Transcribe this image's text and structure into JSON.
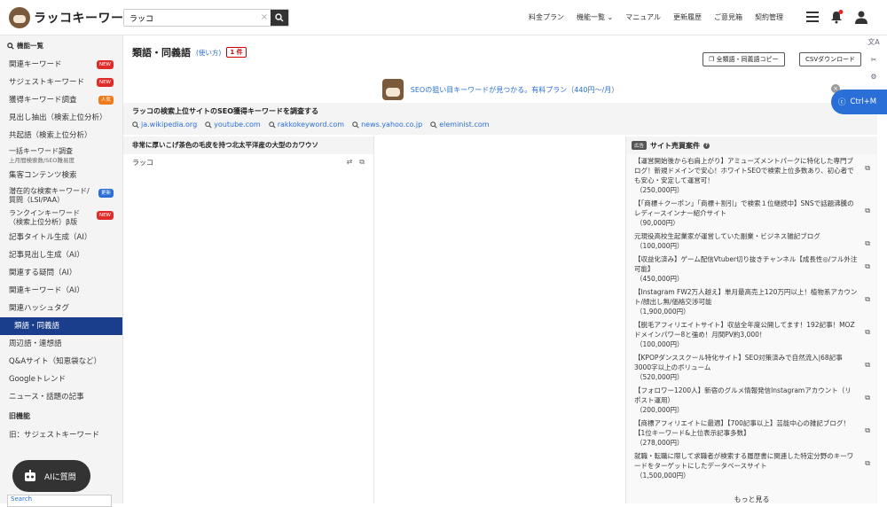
{
  "header": {
    "logo_text": "ラッコキーワード",
    "search_value": "ラッコ",
    "clear_symbol": "×",
    "nav": [
      "料金プラン",
      "機能一覧",
      "マニュアル",
      "更新履歴",
      "ご意見箱",
      "契約管理"
    ]
  },
  "sidebar": {
    "heading": "機能一覧",
    "items": [
      {
        "label": "関連キーワード",
        "badge": "NEW",
        "badge_color": "#e02b2b"
      },
      {
        "label": "サジェストキーワード",
        "badge": "NEW",
        "badge_color": "#e02b2b"
      },
      {
        "label": "獲得キーワード調査",
        "badge": "人気",
        "badge_color": "#f07a1a"
      },
      {
        "label": "見出し抽出（検索上位分析）"
      },
      {
        "label": "共起語（検索上位分析）"
      },
      {
        "label": "一括キーワード調査",
        "sub": "上月間検索数/SEO難易度"
      },
      {
        "label": "集客コンテンツ検索"
      },
      {
        "label": "潜在的な検索キーワード/",
        "sub": "質問（LSI/PAA）",
        "badge": "更新",
        "badge_color": "#2a6fd8"
      },
      {
        "label": "ランクインキーワード",
        "sub": "（検索上位分析）β版",
        "badge": "NEW",
        "badge_color": "#e02b2b"
      },
      {
        "label": "記事タイトル生成（AI）"
      },
      {
        "label": "記事見出し生成（AI）"
      },
      {
        "label": "関連する疑問（AI）"
      },
      {
        "label": "関連キーワード（AI）"
      },
      {
        "label": "関連ハッシュタグ"
      },
      {
        "label": "類語・同義語",
        "active": true
      },
      {
        "label": "周辺語・連想語"
      },
      {
        "label": "Q&Aサイト（知恵袋など）"
      },
      {
        "label": "Googleトレンド"
      },
      {
        "label": "ニュース・話題の記事"
      }
    ],
    "old_section": "旧機能",
    "old_items": [
      {
        "label": "旧：サジェストキーワード"
      }
    ],
    "ai_button": "AIに質問",
    "bottom_banner": "Search"
  },
  "main": {
    "title": "類語・同義語",
    "usage_link": "(使い方)",
    "count": "1 件",
    "copy_button": "全類語・同義語コピー",
    "csv_button": "CSVダウンロード",
    "promo_text": "SEOの狙い目キーワードが見つかる。有料プラン（440円〜/月）",
    "research_title": "ラッコの検索上位サイトのSEO獲得キーワードを調査する",
    "sites": [
      "ja.wikipedia.org",
      "youtube.com",
      "rakkokeyword.com",
      "news.yahoo.co.jp",
      "eleminist.com"
    ],
    "column_heading": "非常に厚いこげ茶色の毛皮を持つ北太平洋産の大型のカワウソ",
    "words": [
      "ラッコ"
    ]
  },
  "listings_panel": {
    "ad_label": "広告",
    "title": "サイト売買案件",
    "items": [
      {
        "text": "【運営開始後から右肩上がり】アミューズメントパークに特化した専門ブログ！新規ドメインで安心！ホワイトSEOで検索上位多数あり、初心者でも安心・安定して運営可！",
        "price": "（250,000円）"
      },
      {
        "text": "【「商標＋クーポン」「商標＋割引」で検索１位継続中】SNSで話題沸騰のレディースインナー紹介サイト",
        "price": "（90,000円）"
      },
      {
        "text": "元現役高校生起業家が運営していた副業・ビジネス雑記ブログ",
        "price": "（100,000円）"
      },
      {
        "text": "【収益化済み】ゲーム配信Vtuber切り抜きチャンネル【成長性◎/フル外注可能】",
        "price": "（450,000円）"
      },
      {
        "text": "【Instagram FW2万人越え】単月最高売上120万円以上！植物系アカウント/顔出し無/価格交渉可能",
        "price": "（1,900,000円）"
      },
      {
        "text": "【脱毛アフィリエイトサイト】収益全年度公開してます！192記事！MOZドメインパワー8と強め！月間PV約3,000！",
        "price": "（100,000円）"
      },
      {
        "text": "【KPOPダンススクール特化サイト】SEO対策済みで自然流入|68記事3000字以上のボリューム",
        "price": "（520,000円）"
      },
      {
        "text": "【フォロワー1200人】新宿のグルメ情報発信Instagramアカウント（リポスト運用）",
        "price": "（200,000円）"
      },
      {
        "text": "【商標アフィリエイトに最適】【700記事以上】芸能中心の雑記ブログ！【1位キーワード&上位表示記事多数】",
        "price": "（278,000円）"
      },
      {
        "text": "就職・転職に際して求職者が検索する履歴書に関連した特定分野のキーワードをターゲットにしたデータベースサイト",
        "price": "（1,500,000円）"
      }
    ],
    "more": "もっと見る"
  },
  "floating": {
    "ctrl_label": "Ctrl+M"
  }
}
